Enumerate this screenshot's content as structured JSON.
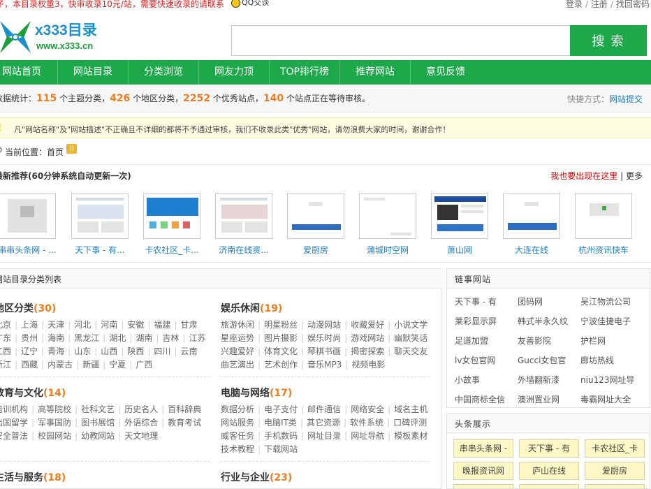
{
  "topbar": {
    "notice": "子，本目录权重3，快审收录10元/站，需要快速收录的请联系",
    "qq": "QQ交谈",
    "links": [
      "登录",
      "注册",
      "找回密码"
    ]
  },
  "header": {
    "logo_text": "x333目录",
    "logo_url": "www.x333.cn",
    "search_placeholder": "",
    "search_button": "搜 索"
  },
  "nav": [
    "网站首页",
    "网站目录",
    "分类浏览",
    "网友力顶",
    "TOP排行榜",
    "推荐网站",
    "意见反馈"
  ],
  "stats": {
    "prefix": "数据统计：",
    "topics": "115",
    "topics_label": " 个主题分类，",
    "regions": "426",
    "regions_label": " 个地区分类，",
    "excellent": "2252",
    "excellent_label": " 个优秀站点，",
    "waiting": "140",
    "waiting_label": " 个站点正在等待审核。",
    "quick_label": "快捷方式：",
    "quick_link": "网站提交"
  },
  "notice": "凡\"网站名称\"及\"网站描述\"不正确且不详细的都将不予通过审核，我们不收录此类\"优秀\"网站，请勿浪费大家的时间，谢谢合作！",
  "crumb": {
    "label": "当前位置：",
    "home": "首页"
  },
  "newrec": {
    "title": "最新推荐",
    "title_note": "(60分钟系统自动更新一次)",
    "appear": "我也要出现在这里",
    "more": "更多",
    "items": [
      "串串头条网 - ...",
      "天下事 - 有...",
      "卡农社区_卡...",
      "济南在线资...",
      "爱厨房",
      "蒲城时空网",
      "萧山网",
      "大连在线",
      "杭州资讯快车"
    ]
  },
  "catpanel": {
    "title": "网站目录分类列表",
    "groups": [
      {
        "name": "地区分类",
        "count": "(30)",
        "rows": [
          [
            "北京",
            "上海",
            "天津",
            "河北",
            "河南",
            "安徽",
            "福建",
            "甘肃"
          ],
          [
            "广东",
            "贵州",
            "海南",
            "黑龙江",
            "湖北",
            "湖南",
            "吉林",
            "江苏"
          ],
          [
            "江西",
            "辽宁",
            "青海",
            "山东",
            "山西",
            "陕西",
            "四川",
            "云南"
          ],
          [
            "浙江",
            "西藏",
            "内蒙古",
            "新疆",
            "宁夏",
            "广西"
          ]
        ]
      },
      {
        "name": "娱乐休闲",
        "count": "(19)",
        "rows": [
          [
            "旅游休闲",
            "明星粉丝",
            "动漫网站",
            "收藏爱好",
            "小说文学"
          ],
          [
            "星座运势",
            "图片摄影",
            "娱乐时尚",
            "游戏网站",
            "幽默笑话"
          ],
          [
            "兴趣爱好",
            "体育文化",
            "琴棋书画",
            "揭密探索",
            "聊天交友"
          ],
          [
            "曲艺演出",
            "艺术创作",
            "音乐MP3",
            "视频电影"
          ]
        ]
      },
      {
        "name": "教育与文化",
        "count": "(14)",
        "rows": [
          [
            "培训机构",
            "高等院校",
            "社科文艺",
            "历史名人",
            "百科辞典"
          ],
          [
            "出国留学",
            "军事国防",
            "图书展馆",
            "外语综合",
            "教育考试"
          ],
          [
            "安全普法",
            "校园网站",
            "幼教网站",
            "天文地理"
          ]
        ]
      },
      {
        "name": "电脑与网络",
        "count": "(17)",
        "rows": [
          [
            "数据分析",
            "电子支付",
            "邮件通信",
            "网络安全",
            "域名主机"
          ],
          [
            "网站服务",
            "电脑IT类",
            "其它资源",
            "软件系统",
            "口碑评测"
          ],
          [
            "威客任务",
            "手机数码",
            "网址目录",
            "网址导航",
            "模板素材"
          ],
          [
            "技术教程",
            "下载网站"
          ]
        ]
      },
      {
        "name": "生活与服务",
        "count": "(18)",
        "rows": []
      },
      {
        "name": "行业与企业",
        "count": "(23)",
        "rows": []
      }
    ]
  },
  "friend": {
    "title": "链事网站",
    "links": [
      "天下事 - 有",
      "团码网",
      "吴江物流公司",
      "莱彩显示屏",
      "韩式半永久纹",
      "宁波佳捷电子",
      "足道加盟",
      "友善影院",
      "护栏网",
      "lv女包官网",
      "Gucci女包官",
      "廊坊热线",
      "小故事",
      "外墙翻新漆",
      "niu123网址导",
      "中国商标全信",
      "澳洲置业网",
      "毒霸网址大全"
    ]
  },
  "head2": {
    "title": "头条展示",
    "tags": [
      "串串头条网 -",
      "天下事 - 有",
      "卡农社区_卡",
      "晚报资讯网",
      "庐山在线",
      "爱厨房"
    ]
  },
  "colors": {
    "brand_green": "#1da849",
    "accent_orange": "#f37b1d",
    "link_blue": "#1b7ec9"
  }
}
